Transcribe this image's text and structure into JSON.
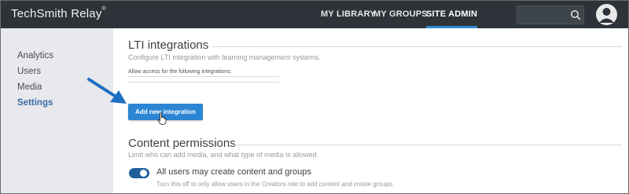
{
  "header": {
    "logo_text": "TechSmith Relay",
    "logo_mark": "®",
    "nav": [
      {
        "label": "MY LIBRARY"
      },
      {
        "label": "MY GROUPS"
      },
      {
        "label": "SITE ADMIN",
        "active": true
      }
    ],
    "search": {
      "placeholder": "",
      "value": ""
    }
  },
  "sidebar": {
    "items": [
      {
        "label": "Analytics"
      },
      {
        "label": "Users"
      },
      {
        "label": "Media"
      },
      {
        "label": "Settings",
        "active": true
      }
    ]
  },
  "main": {
    "lti": {
      "title": "LTI integrations",
      "description": "Configure LTI integration with learning management systems.",
      "access_label": "Allow access for the following integrations:",
      "add_button_label": "Add new integration"
    },
    "content_permissions": {
      "title": "Content permissions",
      "description": "Limit who can add media, and what type of media is allowed.",
      "toggle_label": "All users may create content and groups",
      "toggle_description": "Turn this off to only allow users in the Creators role to add content and create groups.",
      "toggle_on": true
    }
  },
  "colors": {
    "topbar": "#2d3338",
    "accent": "#2b85d3",
    "sidebar_bg": "#e7e9ec",
    "active_link": "#3a6ea5",
    "annotation_arrow": "#1d6fc2"
  },
  "icons": [
    "search-icon",
    "user-avatar-icon",
    "annotation-arrow",
    "hand-cursor-icon"
  ]
}
